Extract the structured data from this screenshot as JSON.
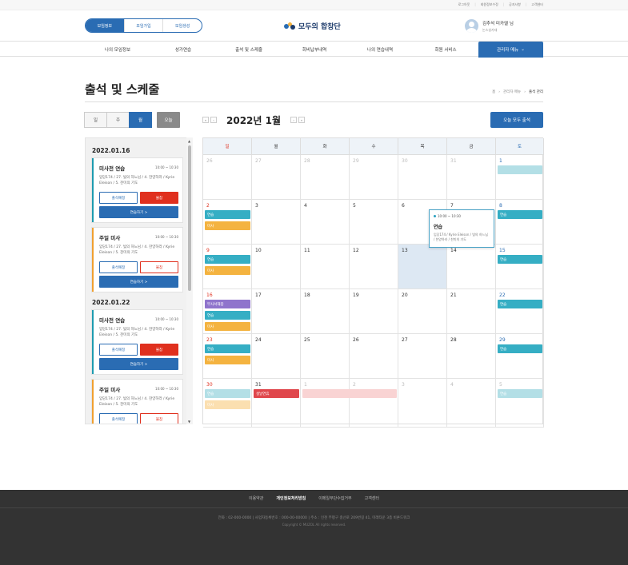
{
  "util_links": [
    "로그아웃",
    "회원정보수정",
    "공지사항",
    "고객센터"
  ],
  "header": {
    "segments": [
      "모임정보",
      "모임가입",
      "모임생성"
    ],
    "logo_text": "모두의 합창단",
    "user_name": "김추석 미카엘 님",
    "user_sub": "논스성가대"
  },
  "nav": [
    "나의 모임정보",
    "성가연습",
    "출석 및 스케줄",
    "회비납부내역",
    "나의 연습내역",
    "회원 서비스",
    "관리자 메뉴"
  ],
  "page": {
    "title": "출석 및 스케줄",
    "breadcrumb": [
      "홈",
      "관리자 메뉴",
      "출석 관리"
    ]
  },
  "toolbar": {
    "views": [
      "일",
      "주",
      "월"
    ],
    "today": "오늘",
    "month_title": "2022년 1월",
    "all_attend": "오늘 모두 출석",
    "prev_year": "«",
    "prev_month": "‹",
    "next_month": "›",
    "next_year": "»"
  },
  "schedule": [
    {
      "date": "2022.01.16",
      "cards": [
        {
          "title": "미사전 연습",
          "time": "10:00 ~ 10:30",
          "desc": "입당174 / 27. 빛의 하느님 / 4. 찬양하라 / Kyrie Eleison / 5. 찬미의 기도",
          "btn_a": "출석예정",
          "btn_b": "불참",
          "btn_go": "연습하기 >",
          "bar": "#1e9bb0",
          "b_style": "red"
        },
        {
          "title": "주일 미사",
          "time": "10:00 ~ 10:30",
          "desc": "입당174 / 27. 빛의 하느님 / 4. 찬양하라 / Kyrie Eleison / 5. 찬미의 기도",
          "btn_a": "출석예정",
          "btn_b": "불참",
          "btn_go": "연습하기 >",
          "bar": "#f0a030",
          "b_style": "out"
        }
      ]
    },
    {
      "date": "2022.01.22",
      "cards": [
        {
          "title": "미사전 연습",
          "time": "10:00 ~ 10:30",
          "desc": "입당174 / 27. 빛의 하느님 / 4. 찬양하라 / Kyrie Eleison / 5. 찬미의 기도",
          "btn_a": "출석예정",
          "btn_b": "불참",
          "btn_go": "연습하기 >",
          "bar": "#1e9bb0",
          "b_style": "red"
        },
        {
          "title": "주일 미사",
          "time": "10:00 ~ 10:30",
          "desc": "입당174 / 27. 빛의 하느님 / 4. 찬양하라 / Kyrie Eleison / 5. 찬미의 기도",
          "btn_a": "출석예정",
          "btn_b": "불참",
          "btn_go": "연습하기 >",
          "bar": "#f0a030",
          "b_style": "out"
        }
      ]
    }
  ],
  "calendar": {
    "weekdays": [
      "일",
      "월",
      "화",
      "수",
      "목",
      "금",
      "토"
    ],
    "weeks": [
      [
        {
          "d": "26",
          "dim": true
        },
        {
          "d": "27",
          "dim": true
        },
        {
          "d": "28",
          "dim": true
        },
        {
          "d": "29",
          "dim": true
        },
        {
          "d": "30",
          "dim": true
        },
        {
          "d": "31",
          "dim": true
        },
        {
          "d": "1"
        }
      ],
      [
        {
          "d": "2"
        },
        {
          "d": "3"
        },
        {
          "d": "4"
        },
        {
          "d": "5"
        },
        {
          "d": "6"
        },
        {
          "d": "7"
        },
        {
          "d": "8"
        }
      ],
      [
        {
          "d": "9"
        },
        {
          "d": "10"
        },
        {
          "d": "11"
        },
        {
          "d": "12"
        },
        {
          "d": "13",
          "today": true
        },
        {
          "d": "14"
        },
        {
          "d": "15"
        }
      ],
      [
        {
          "d": "16"
        },
        {
          "d": "17"
        },
        {
          "d": "18"
        },
        {
          "d": "19"
        },
        {
          "d": "20"
        },
        {
          "d": "21"
        },
        {
          "d": "22"
        }
      ],
      [
        {
          "d": "23"
        },
        {
          "d": "24"
        },
        {
          "d": "25"
        },
        {
          "d": "26"
        },
        {
          "d": "27"
        },
        {
          "d": "28"
        },
        {
          "d": "29"
        }
      ],
      [
        {
          "d": "30"
        },
        {
          "d": "31"
        },
        {
          "d": "1",
          "dim": true
        },
        {
          "d": "2",
          "dim": true
        },
        {
          "d": "3",
          "dim": true
        },
        {
          "d": "4",
          "dim": true
        },
        {
          "d": "5",
          "dim": true
        }
      ]
    ],
    "events": [
      {
        "week": 0,
        "col": 6,
        "slot": 0,
        "span": 1,
        "label": "",
        "color": "#b3dfe6"
      },
      {
        "week": 1,
        "col": 0,
        "slot": 0,
        "span": 1,
        "label": "연습",
        "color": "#35aec4"
      },
      {
        "week": 1,
        "col": 0,
        "slot": 1,
        "span": 1,
        "label": "미사",
        "color": "#f4b340"
      },
      {
        "week": 1,
        "col": 6,
        "slot": 0,
        "span": 1,
        "label": "연습",
        "color": "#35aec4"
      },
      {
        "week": 2,
        "col": 0,
        "slot": 0,
        "span": 1,
        "label": "연습",
        "color": "#35aec4"
      },
      {
        "week": 2,
        "col": 0,
        "slot": 1,
        "span": 1,
        "label": "미사",
        "color": "#f4b340"
      },
      {
        "week": 2,
        "col": 6,
        "slot": 0,
        "span": 1,
        "label": "연습",
        "color": "#35aec4"
      },
      {
        "week": 3,
        "col": 0,
        "slot": 0,
        "span": 1,
        "label": "부사서재중",
        "color": "#8f74cc"
      },
      {
        "week": 3,
        "col": 0,
        "slot": 1,
        "span": 1,
        "label": "연습",
        "color": "#35aec4"
      },
      {
        "week": 3,
        "col": 0,
        "slot": 2,
        "span": 1,
        "label": "미사",
        "color": "#f4b340"
      },
      {
        "week": 3,
        "col": 6,
        "slot": 0,
        "span": 1,
        "label": "연습",
        "color": "#35aec4"
      },
      {
        "week": 4,
        "col": 0,
        "slot": 0,
        "span": 1,
        "label": "연습",
        "color": "#35aec4"
      },
      {
        "week": 4,
        "col": 0,
        "slot": 1,
        "span": 1,
        "label": "미사",
        "color": "#f4b340"
      },
      {
        "week": 4,
        "col": 6,
        "slot": 0,
        "span": 1,
        "label": "연습",
        "color": "#35aec4"
      },
      {
        "week": 5,
        "col": 0,
        "slot": 0,
        "span": 1,
        "label": "연습",
        "color": "#b3dfe6"
      },
      {
        "week": 5,
        "col": 0,
        "slot": 1,
        "span": 1,
        "label": "미사",
        "color": "#fbdfb0"
      },
      {
        "week": 5,
        "col": 1,
        "slot": 0,
        "span": 1,
        "label": "설날연휴",
        "color": "#e0474c"
      },
      {
        "week": 5,
        "col": 2,
        "slot": 0,
        "span": 2,
        "label": "",
        "color": "#f9d3d3"
      },
      {
        "week": 5,
        "col": 6,
        "slot": 0,
        "span": 1,
        "label": "연습",
        "color": "#b3dfe6"
      }
    ],
    "popup": {
      "time": "10:00 ~ 10:30",
      "title": "연습",
      "desc": "입당174 / Kyrie Eleison / 빛의 하느님 / 찬양하라 / 찬미의 기도"
    }
  },
  "footer": {
    "links": [
      "이용약관",
      "개인정보처리방침",
      "이메일무단수집거부",
      "고객센터"
    ],
    "info": "전화 : 02-000-0000   |   사업자등록번호 : 000-00-00000   |   주소 : 인천 부평구 충선로 209번길 41, 미래타운 3층 비욘드워크",
    "copy": "Copyright © MUZOL All rights reserved."
  }
}
